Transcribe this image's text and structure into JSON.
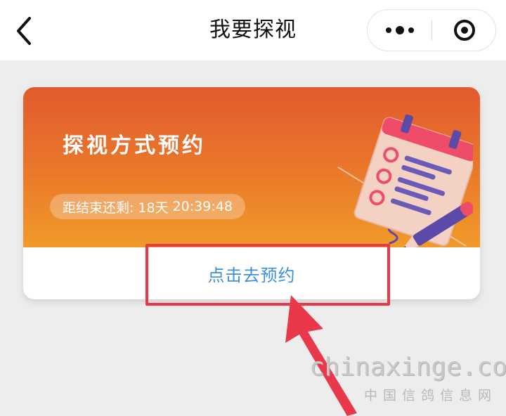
{
  "nav": {
    "title": "我要探视",
    "back_icon": "chevron-left-icon",
    "more_icon": "more-dots-icon",
    "close_icon": "target-close-icon"
  },
  "card": {
    "title": "探视方式预约",
    "countdown_label": "距结束还剩:",
    "countdown_days": "18天",
    "countdown_time": "20:39:48",
    "cta_label": "点击去预约",
    "illustration_icon": "calendar-pencil-icon"
  },
  "watermark": {
    "main": "chinaxinge.com",
    "sub": "中国信鸽信息网"
  },
  "colors": {
    "banner_top": "#e25a2e",
    "banner_bottom": "#f19a2a",
    "cta_text": "#3d8fd8",
    "highlight": "#e8384a"
  }
}
